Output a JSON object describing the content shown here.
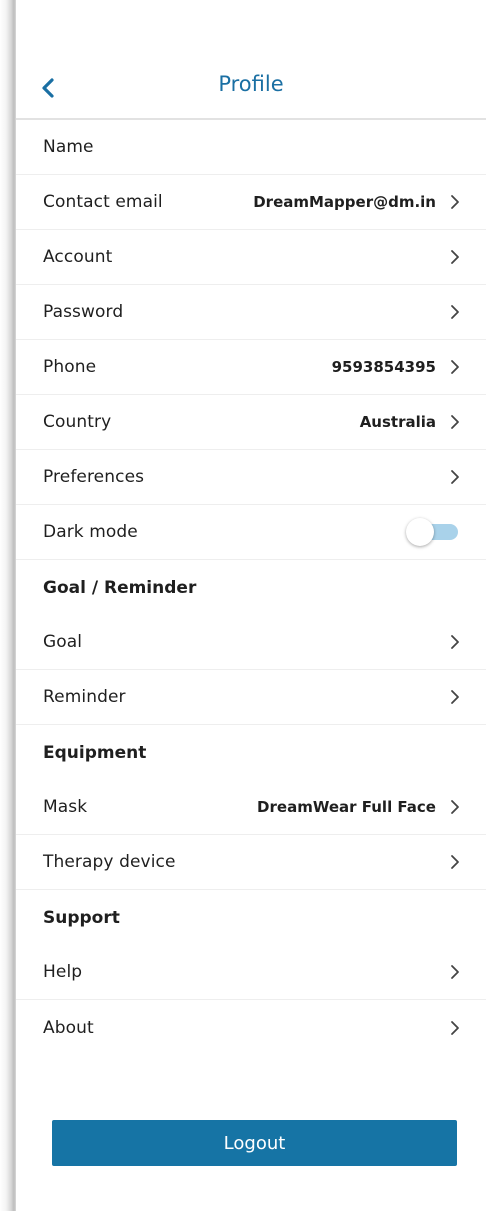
{
  "header": {
    "title": "Profile",
    "back_icon": "chevron-left-icon"
  },
  "colors": {
    "accent": "#1a6fa3",
    "button": "#1674a5",
    "toggle_track": "#a9d2ea"
  },
  "account_section": {
    "name_label": "Name",
    "contact_email_label": "Contact email",
    "contact_email_value": "DreamMapper@dm.in",
    "account_label": "Account",
    "password_label": "Password",
    "phone_label": "Phone",
    "phone_value": "9593854395",
    "country_label": "Country",
    "country_value": "Australia",
    "preferences_label": "Preferences",
    "dark_mode_label": "Dark mode",
    "dark_mode_on": false
  },
  "goal_section": {
    "heading": "Goal / Reminder",
    "goal_label": "Goal",
    "reminder_label": "Reminder"
  },
  "equipment_section": {
    "heading": "Equipment",
    "mask_label": "Mask",
    "mask_value": "DreamWear Full Face",
    "therapy_device_label": "Therapy device"
  },
  "support_section": {
    "heading": "Support",
    "help_label": "Help",
    "about_label": "About"
  },
  "logout_label": "Logout"
}
